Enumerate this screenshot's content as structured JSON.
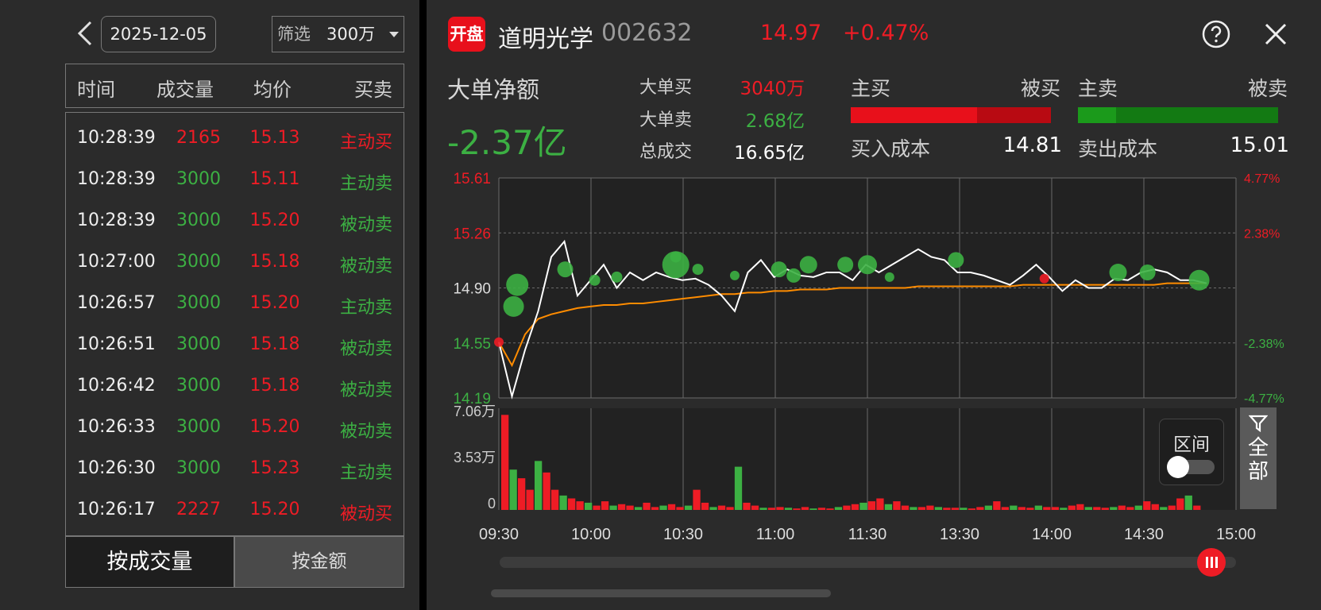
{
  "left": {
    "date": "2025-12-05",
    "filter_label": "筛选",
    "filter_value": "300万",
    "headers": [
      "时间",
      "成交量",
      "均价",
      "买卖"
    ],
    "rows": [
      {
        "time": "10:28:39",
        "vol": "2165",
        "price": "15.13",
        "side": "主动买",
        "vol_color": "red",
        "side_color": "red"
      },
      {
        "time": "10:28:39",
        "vol": "3000",
        "price": "15.11",
        "side": "主动卖",
        "vol_color": "green",
        "side_color": "green"
      },
      {
        "time": "10:28:39",
        "vol": "3000",
        "price": "15.20",
        "side": "被动卖",
        "vol_color": "green",
        "side_color": "green"
      },
      {
        "time": "10:27:00",
        "vol": "3000",
        "price": "15.18",
        "side": "被动卖",
        "vol_color": "green",
        "side_color": "green"
      },
      {
        "time": "10:26:57",
        "vol": "3000",
        "price": "15.20",
        "side": "主动卖",
        "vol_color": "green",
        "side_color": "green"
      },
      {
        "time": "10:26:51",
        "vol": "3000",
        "price": "15.18",
        "side": "被动卖",
        "vol_color": "green",
        "side_color": "green"
      },
      {
        "time": "10:26:42",
        "vol": "3000",
        "price": "15.18",
        "side": "被动卖",
        "vol_color": "green",
        "side_color": "green"
      },
      {
        "time": "10:26:33",
        "vol": "3000",
        "price": "15.20",
        "side": "被动卖",
        "vol_color": "green",
        "side_color": "green"
      },
      {
        "time": "10:26:30",
        "vol": "3000",
        "price": "15.23",
        "side": "主动卖",
        "vol_color": "green",
        "side_color": "green"
      },
      {
        "time": "10:26:17",
        "vol": "2227",
        "price": "15.20",
        "side": "被动买",
        "vol_color": "red",
        "side_color": "red"
      }
    ],
    "tab_vol": "按成交量",
    "tab_amt": "按金额"
  },
  "header": {
    "logo": "开盘",
    "name": "道明光学",
    "code": "002632",
    "price": "14.97",
    "change": "+0.47%"
  },
  "summary": {
    "net_title": "大单净额",
    "net_value": "-2.37亿",
    "big_buy_label": "大单买",
    "big_buy_value": "3040万",
    "big_sell_label": "大单卖",
    "big_sell_value": "2.68亿",
    "total_label": "总成交",
    "total_value": "16.65亿",
    "active_buy": "主买",
    "passive_buy": "被买",
    "active_sell": "主卖",
    "passive_sell": "被卖",
    "buy_active_ratio": 0.63,
    "sell_active_ratio": 0.19,
    "buy_cost_label": "买入成本",
    "buy_cost_value": "14.81",
    "sell_cost_label": "卖出成本",
    "sell_cost_value": "15.01"
  },
  "colors": {
    "red": "#ee1c25",
    "green": "#3cb043",
    "price_line": "#ffffff",
    "avg_line": "#ff8c00",
    "grid": "#6a6a6a"
  },
  "chart_data": {
    "type": "line",
    "y_left_labels": [
      "15.61",
      "15.26",
      "14.90",
      "14.55",
      "14.19"
    ],
    "y_right_labels": [
      "4.77%",
      "2.38%",
      "",
      "-2.38%",
      "-4.77%"
    ],
    "ylim": [
      14.19,
      15.61
    ],
    "x_labels": [
      "09:30",
      "10:00",
      "10:30",
      "11:00",
      "11:30",
      "13:30",
      "14:00",
      "14:30",
      "15:00"
    ],
    "vol_labels": [
      "7.06万",
      "3.53万",
      "0"
    ],
    "vol_max": 70600,
    "price_series": [
      14.55,
      14.2,
      14.5,
      14.75,
      15.1,
      15.2,
      14.85,
      14.95,
      15.05,
      14.9,
      15.0,
      14.95,
      15.0,
      14.97,
      14.95,
      14.96,
      14.92,
      14.85,
      14.75,
      15.0,
      15.08,
      14.97,
      15.02,
      14.98,
      14.97,
      15.0,
      15.0,
      14.95,
      15.05,
      15.0,
      15.05,
      15.1,
      15.15,
      15.1,
      15.08,
      15.0,
      15.0,
      14.98,
      14.95,
      14.92,
      14.98,
      15.05,
      14.97,
      14.88,
      14.95,
      14.9,
      14.9,
      14.96,
      14.95,
      15.0,
      15.02,
      15.0,
      14.95,
      14.95,
      14.93
    ],
    "avg_series": [
      14.55,
      14.4,
      14.6,
      14.7,
      14.73,
      14.75,
      14.77,
      14.78,
      14.79,
      14.79,
      14.8,
      14.8,
      14.81,
      14.82,
      14.83,
      14.84,
      14.85,
      14.86,
      14.86,
      14.87,
      14.87,
      14.88,
      14.88,
      14.89,
      14.89,
      14.89,
      14.9,
      14.9,
      14.9,
      14.9,
      14.9,
      14.9,
      14.91,
      14.91,
      14.91,
      14.91,
      14.91,
      14.91,
      14.91,
      14.91,
      14.92,
      14.92,
      14.92,
      14.92,
      14.92,
      14.92,
      14.92,
      14.92,
      14.92,
      14.92,
      14.92,
      14.93,
      14.93,
      14.93,
      14.93
    ],
    "bubbles": [
      {
        "t": 0.02,
        "p": 14.78,
        "s": "green",
        "r": 13
      },
      {
        "t": 0.025,
        "p": 14.92,
        "s": "green",
        "r": 14
      },
      {
        "t": 0.09,
        "p": 15.02,
        "s": "green",
        "r": 10
      },
      {
        "t": 0.13,
        "p": 14.95,
        "s": "green",
        "r": 7
      },
      {
        "t": 0.16,
        "p": 14.97,
        "s": "green",
        "r": 7
      },
      {
        "t": 0.24,
        "p": 15.05,
        "s": "green",
        "r": 17
      },
      {
        "t": 0.24,
        "p": 15.1,
        "s": "green",
        "r": 7
      },
      {
        "t": 0.27,
        "p": 15.02,
        "s": "green",
        "r": 7
      },
      {
        "t": 0.32,
        "p": 14.98,
        "s": "green",
        "r": 6
      },
      {
        "t": 0.38,
        "p": 15.02,
        "s": "green",
        "r": 10
      },
      {
        "t": 0.4,
        "p": 14.98,
        "s": "green",
        "r": 9
      },
      {
        "t": 0.42,
        "p": 15.05,
        "s": "green",
        "r": 11
      },
      {
        "t": 0.47,
        "p": 15.05,
        "s": "green",
        "r": 10
      },
      {
        "t": 0.5,
        "p": 15.05,
        "s": "green",
        "r": 12
      },
      {
        "t": 0.53,
        "p": 14.97,
        "s": "green",
        "r": 6
      },
      {
        "t": 0.62,
        "p": 15.08,
        "s": "green",
        "r": 10
      },
      {
        "t": 0.74,
        "p": 14.96,
        "s": "red",
        "r": 6
      },
      {
        "t": 0.84,
        "p": 15.0,
        "s": "green",
        "r": 11
      },
      {
        "t": 0.88,
        "p": 15.0,
        "s": "green",
        "r": 10
      },
      {
        "t": 0.95,
        "p": 14.95,
        "s": "green",
        "r": 13
      },
      {
        "t": 0.0,
        "p": 14.55,
        "s": "red",
        "r": 6
      }
    ],
    "volume_bars": [
      66000,
      28000,
      22000,
      14000,
      34000,
      26000,
      14000,
      10000,
      8000,
      6000,
      5000,
      3000,
      6000,
      3000,
      4000,
      3000,
      2000,
      5000,
      2000,
      3000,
      4000,
      2000,
      3000,
      14000,
      5000,
      2000,
      3000,
      2000,
      30000,
      5000,
      3000,
      1500,
      1500,
      2000,
      1500,
      1000,
      2000,
      1000,
      1500,
      1000,
      2000,
      3000,
      4000,
      5000,
      6000,
      8000,
      4000,
      6000,
      3000,
      2000,
      2000,
      3000,
      2000,
      1500,
      1500,
      1500,
      1000,
      2000,
      3000,
      6000,
      2000,
      3000,
      2000,
      1500,
      3000,
      2000,
      2000,
      1500,
      3000,
      4000,
      2000,
      2000,
      1500,
      2000,
      3000,
      2000,
      3000,
      6000,
      4000,
      2000,
      3000,
      8000,
      10000,
      3000
    ]
  },
  "controls": {
    "range_label": "区间",
    "all_label": "全部"
  }
}
